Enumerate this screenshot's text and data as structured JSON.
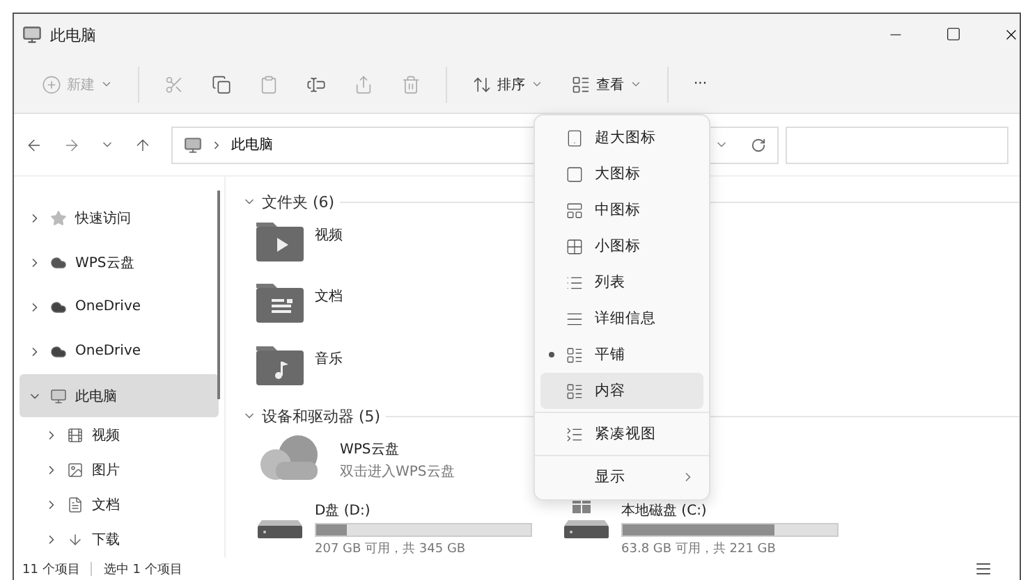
{
  "window": {
    "title": "此电脑"
  },
  "toolbar": [
    {
      "kind": "new",
      "label": "新建",
      "disabled": true
    },
    {
      "kind": "cut",
      "disabled": true
    },
    {
      "kind": "copy",
      "disabled": false
    },
    {
      "kind": "paste",
      "disabled": true
    },
    {
      "kind": "rename",
      "disabled": false
    },
    {
      "kind": "share",
      "disabled": true
    },
    {
      "kind": "delete",
      "disabled": true
    },
    {
      "kind": "sort",
      "label": "排序",
      "disabled": false
    },
    {
      "kind": "view",
      "label": "查看",
      "disabled": false
    },
    {
      "kind": "more",
      "label": "···",
      "disabled": false
    }
  ],
  "address": {
    "path": "此电脑"
  },
  "sidebar": {
    "items": [
      {
        "label": "快速访问",
        "kind": "star",
        "expanded": false,
        "selected": false
      },
      {
        "label": "WPS云盘",
        "kind": "wps",
        "expanded": false,
        "selected": false
      },
      {
        "label": "OneDrive",
        "kind": "cloud",
        "expanded": false,
        "selected": false
      },
      {
        "label": "OneDrive",
        "kind": "cloud",
        "expanded": false,
        "selected": false
      },
      {
        "label": "此电脑",
        "kind": "pc",
        "expanded": true,
        "selected": true,
        "children": [
          {
            "label": "视频",
            "kind": "video",
            "expanded": false,
            "selected": false
          },
          {
            "label": "图片",
            "kind": "image",
            "expanded": false,
            "selected": false
          },
          {
            "label": "文档",
            "kind": "doc",
            "expanded": false,
            "selected": false
          },
          {
            "label": "下载",
            "kind": "download",
            "expanded": false,
            "selected": false
          }
        ]
      }
    ]
  },
  "folders": {
    "title": "文件夹 (6)",
    "items": [
      {
        "name": "视频",
        "kind": "video"
      },
      {
        "name": "文档",
        "kind": "doc"
      },
      {
        "name": "音乐",
        "kind": "music"
      }
    ]
  },
  "devices": {
    "title": "设备和驱动器 (5)",
    "cloud": {
      "name": "WPS云盘",
      "subtitle": "双击进入WPS云盘"
    },
    "drives": [
      {
        "name": "D盘 (D:)",
        "kind": "disk",
        "level": 0.14,
        "space": "207 GB 可用，共 345 GB"
      },
      {
        "name": "本地磁盘 (C:)",
        "kind": "system",
        "level": 0.71,
        "space": "63.8 GB 可用，共 221 GB"
      }
    ]
  },
  "view_menu": {
    "groups": [
      [
        {
          "label": "超大图标",
          "selected": false,
          "highlighted": false
        },
        {
          "label": "大图标",
          "selected": false,
          "highlighted": false
        },
        {
          "label": "中图标",
          "selected": false,
          "highlighted": false
        },
        {
          "label": "小图标",
          "selected": false,
          "highlighted": false
        },
        {
          "label": "列表",
          "selected": false,
          "highlighted": false
        },
        {
          "label": "详细信息",
          "selected": false,
          "highlighted": false
        },
        {
          "label": "平铺",
          "selected": true,
          "highlighted": false
        },
        {
          "label": "内容",
          "selected": false,
          "highlighted": true
        }
      ],
      [
        {
          "label": "紧凑视图",
          "selected": false,
          "highlighted": false
        }
      ],
      [
        {
          "label": "显示",
          "selected": false,
          "highlighted": false,
          "submenu": true
        }
      ]
    ]
  },
  "status_bar": {
    "count": "11 个项目",
    "selection": "选中 1 个项目"
  }
}
